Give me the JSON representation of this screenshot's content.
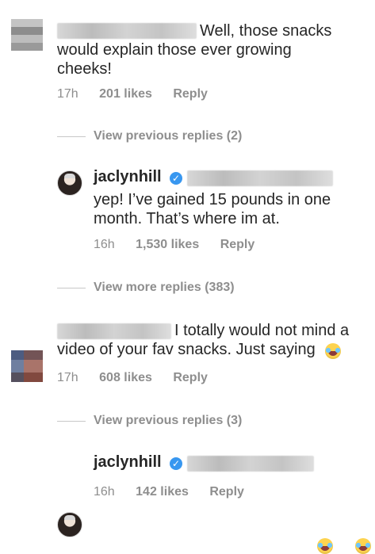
{
  "comments": [
    {
      "text_line_1": "Well, those snacks",
      "text_line_2": "would explain those ever growing",
      "text_line_3": "cheeks!",
      "time": "17h",
      "likes": "201 likes",
      "reply": "Reply",
      "view_replies": "View previous replies (2)"
    },
    {
      "text_line_1": "I totally would not mind a",
      "text_line_2": "video of your fav snacks. Just saying",
      "time": "17h",
      "likes": "608 likes",
      "reply": "Reply",
      "view_replies": "View previous replies (3)"
    }
  ],
  "replies": [
    {
      "username": "jaclynhill",
      "text_line_1": "yep! I’ve gained 15 pounds in one",
      "text_line_2": "month. That’s where im at.",
      "time": "16h",
      "likes": "1,530 likes",
      "reply": "Reply"
    },
    {
      "username": "jaclynhill",
      "time": "16h",
      "likes": "142 likes",
      "reply": "Reply"
    }
  ],
  "view_more_replies": "View more replies (383)"
}
